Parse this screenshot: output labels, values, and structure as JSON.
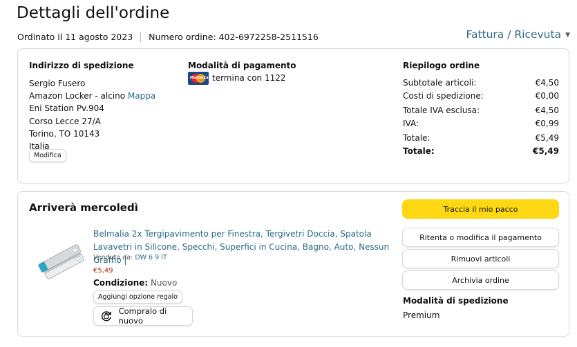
{
  "header": {
    "title": "Dettagli dell'ordine",
    "order_date": "Ordinato il 11 agosto 2023",
    "order_number": "Numero ordine: 402-6972258-2511516",
    "invoice_link": "Fattura / Ricevuta"
  },
  "shipping_address": {
    "title": "Indirizzo di spedizione",
    "name": "Sergio Fusero",
    "line1": "Amazon Locker - alcino",
    "map_link": "Mappa",
    "line2": "Eni Station Pv.904",
    "line3": "Corso Lecce 27/A",
    "line4": "Torino, TO 10143",
    "country": "Italia",
    "edit_button": "Modifica"
  },
  "payment": {
    "title": "Modalità di pagamento",
    "card_text": "termina con 1122",
    "card_icon": "mastercard-icon"
  },
  "summary": {
    "title": "Riepilogo ordine",
    "rows": [
      {
        "label": "Subtotale articoli:",
        "value": "€4,50"
      },
      {
        "label": "Costi di spedizione:",
        "value": "€0,00"
      },
      {
        "label": "Totale IVA esclusa:",
        "value": "€4,50"
      },
      {
        "label": "IVA:",
        "value": "€0,99"
      },
      {
        "label": "Totale:",
        "value": "€5,49"
      },
      {
        "label": "Totale:",
        "value": "€5,49"
      }
    ]
  },
  "delivery": {
    "title": "Arriverà mercoledì",
    "product_title": "Belmalia 2x Tergipavimento per Finestra, Tergivetri Doccia, Spatola Lavavetri in Silicone, Specchi, Superfici in Cucina, Bagno, Auto, Nessun Graffio |",
    "seller_label": "Venduto da:",
    "seller_name": "DW 6 9 IT",
    "price": "€5,49",
    "condition_label": "Condizione:",
    "condition_value": "Nuovo",
    "gift_button": "Aggiungi opzione regalo",
    "buy_again_button": "Compralo di nuovo",
    "buy_again_icon": "buy-again-icon",
    "track_button": "Traccia il mio pacco",
    "retry_payment_button": "Ritenta o modifica il pagamento",
    "remove_items_button": "Rimuovi articoli",
    "archive_button": "Archivia ordine",
    "shipping_method_title": "Modalità di spedizione",
    "shipping_method_value": "Premium"
  },
  "colors": {
    "link": "#2a6b83",
    "price": "#b12704",
    "primary_button": "#ffd814"
  }
}
